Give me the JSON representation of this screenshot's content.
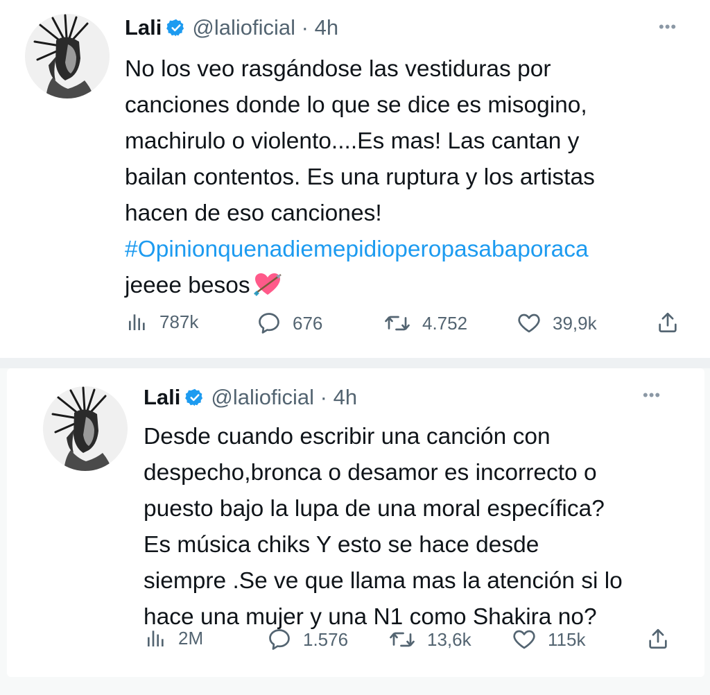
{
  "tweets": [
    {
      "name": "Lali",
      "handle": "@lalioficial · 4h",
      "more": "•••",
      "lines": [
        "No los veo rasgándose las vestiduras por",
        "canciones donde lo que se dice es misogino,",
        "machirulo o violento....Es mas! Las cantan y",
        "bailan contentos. Es una ruptura y los artistas",
        "hacen de eso canciones!"
      ],
      "hashtag": "#Opinionquenadiemepidioperopasabaporaca",
      "last_line": "jeeee besos",
      "emoji": "heart-with-arrow-emoji",
      "stats": {
        "views": "787k",
        "replies": "676",
        "retweets": "4.752",
        "likes": "39,9k"
      }
    },
    {
      "name": "Lali",
      "handle": "@lalioficial · 4h",
      "more": "•••",
      "lines": [
        "Desde cuando escribir una canción con",
        "despecho,bronca o desamor es incorrecto o",
        "puesto bajo la lupa de una moral específica?",
        "Es música chiks Y esto se hace desde",
        "siempre .Se ve que llama mas la atención si lo",
        "hace una mujer y una N1 como Shakira no?"
      ],
      "stats": {
        "views": "2M",
        "replies": "1.576",
        "retweets": "13,6k",
        "likes": "115k"
      }
    }
  ],
  "colors": {
    "hashtag": "#1d9bf0",
    "verified": "#1d9bf0",
    "secondary_text": "#536471",
    "primary_text": "#0f1419",
    "heart_emoji": "#ff5a8a"
  }
}
